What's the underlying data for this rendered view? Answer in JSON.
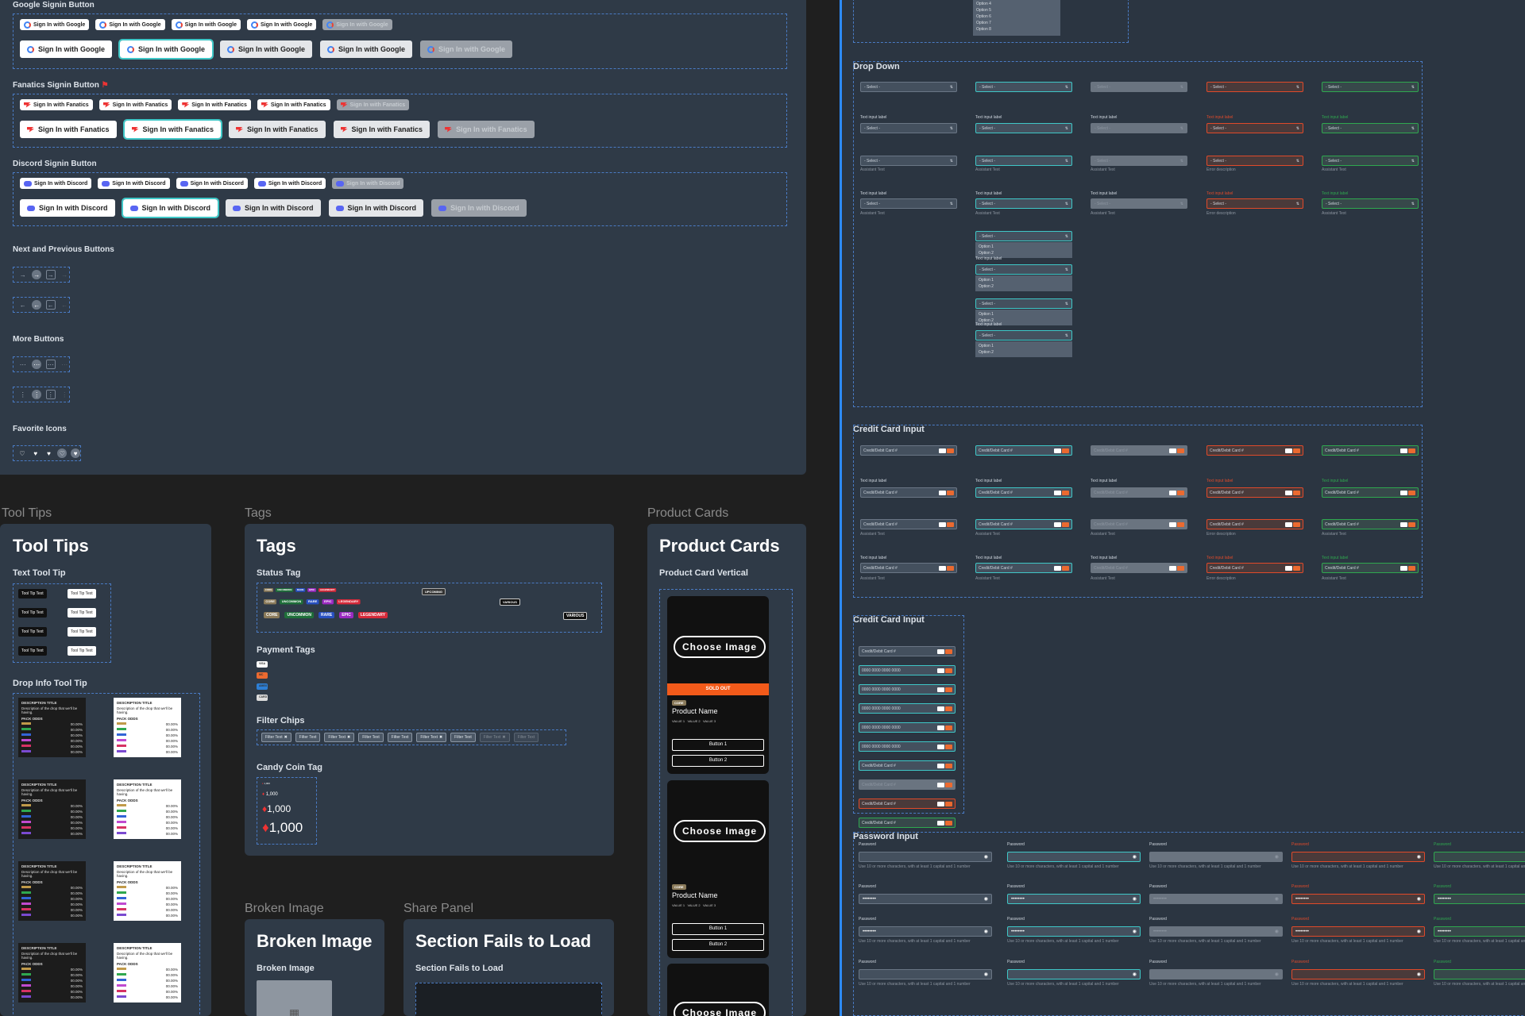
{
  "signin": {
    "google": {
      "title": "Google Signin Button",
      "label": "Sign In with Google"
    },
    "fanatics": {
      "title": "Fanatics Signin Button",
      "label": "Sign In with Fanatics"
    },
    "discord": {
      "title": "Discord Signin Button",
      "label": "Sign In with Discord"
    }
  },
  "misc": {
    "next_prev_title": "Next and Previous Buttons",
    "more_buttons_title": "More Buttons",
    "favorite_title": "Favorite Icons"
  },
  "sections": {
    "tooltips": "Tool Tips",
    "tags": "Tags",
    "product_cards": "Product Cards",
    "broken_image": "Broken Image",
    "share_panel": "Share Panel"
  },
  "tooltips": {
    "heading": "Tool Tips",
    "text_tooltip_title": "Text Tool Tip",
    "tooltip_text": "Tool Tip Text",
    "drop_info_title": "Drop Info Tool Tip",
    "drop_desc_title": "DESCRIPTION TITLE",
    "drop_desc": "Description of the drop that we'll be having.",
    "pack_odds": "PACK ODDS",
    "odds_value": "00.00%"
  },
  "tags": {
    "heading": "Tags",
    "status_title": "Status Tag",
    "status": [
      "CORE",
      "UNCOMMON",
      "RARE",
      "EPIC",
      "LEGENDARY"
    ],
    "upcoming": "UPCOMING",
    "various": "VARIOUS",
    "payment_title": "Payment Tags",
    "payment": [
      "VISA",
      "MC",
      "AMEX",
      "CARD"
    ],
    "filter_title": "Filter Chips",
    "filter_label": "Filter Text",
    "candy_title": "Candy Coin Tag",
    "candy_value": "1,000"
  },
  "product": {
    "heading": "Product Cards",
    "vertical_title": "Product Card Vertical",
    "choose": "Choose Image",
    "sold_out": "SOLD OUT",
    "core": "CORE",
    "name": "Product Name",
    "values": "VALUE 1   VALUE 2   VALUE 3",
    "button1": "Button 1",
    "button2": "Button 2"
  },
  "broken": {
    "heading": "Broken Image",
    "sub": "Broken Image"
  },
  "share": {
    "heading": "Section Fails to Load",
    "sub": "Section Fails to Load"
  },
  "dropdown": {
    "title": "Drop Down",
    "placeholder": "- Select -",
    "label": "Text input label",
    "assistant": "Assistant Text",
    "error": "Error description",
    "options": [
      "Option 1",
      "Option 2"
    ],
    "top_options": [
      "Option 4",
      "Option 5",
      "Option 6",
      "Option 7",
      "Option 8"
    ]
  },
  "credit": {
    "title": "Credit Card Input",
    "placeholder": "Credit/Debit Card #",
    "number": "0000 0000 0000 0000",
    "label": "Text input label",
    "assistant": "Assistant Text",
    "error": "Error description"
  },
  "password": {
    "title": "Password Input",
    "label": "Password",
    "hint": "Use 10 or more characters, with at least 1 capital and 1 number",
    "masked": "••••••••",
    "error": "Error description"
  },
  "colors": {
    "focus": "#3fc7c7",
    "error": "#e04a2a",
    "success": "#2fa84f",
    "panel": "#2f3a47",
    "dash": "#4a7bc4"
  }
}
